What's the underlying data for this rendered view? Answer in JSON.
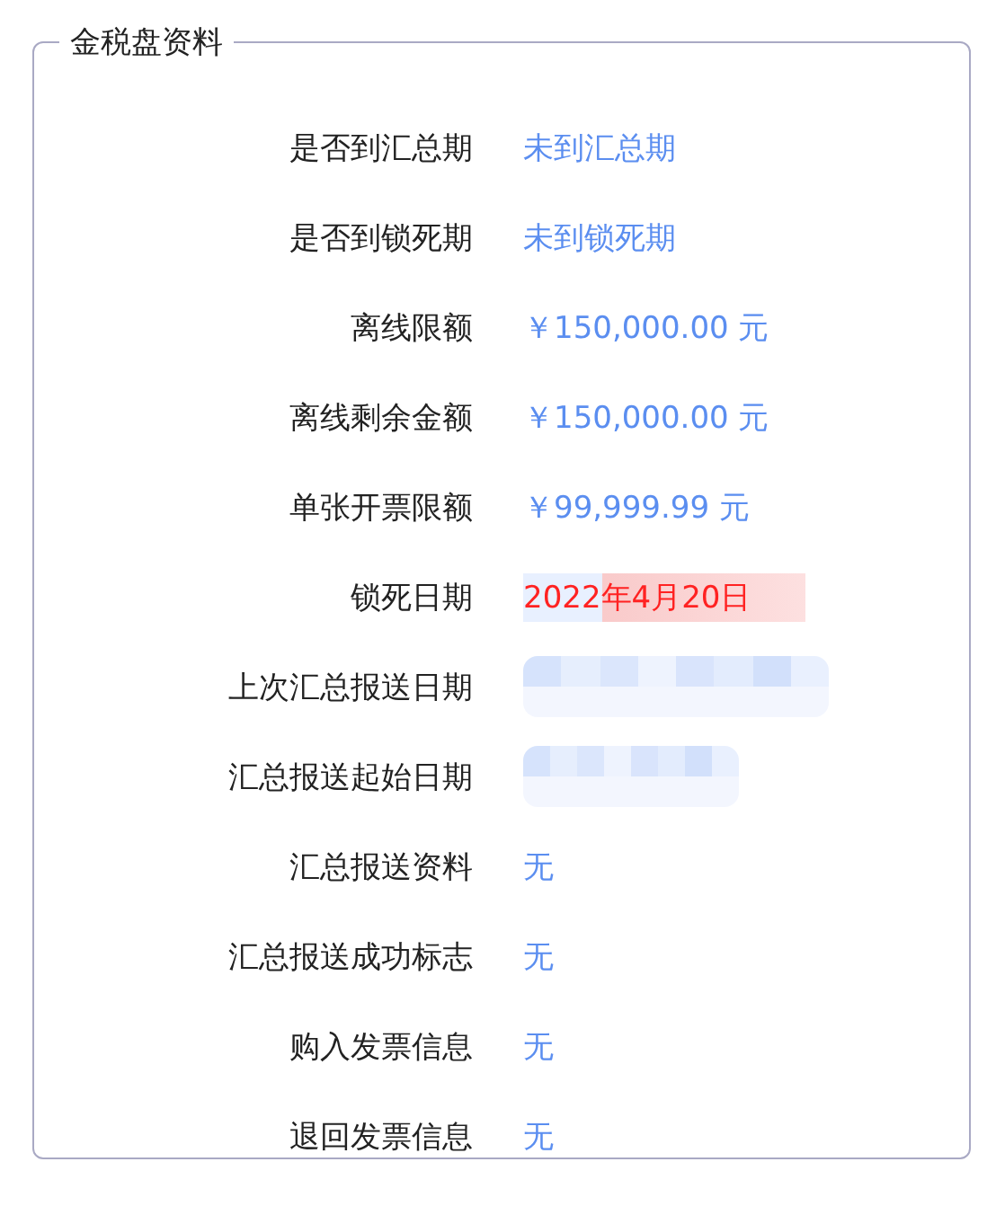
{
  "panel": {
    "title": "金税盘资料",
    "rows": [
      {
        "label": "是否到汇总期",
        "kind": "text",
        "value": "未到汇总期"
      },
      {
        "label": "是否到锁死期",
        "kind": "text",
        "value": "未到锁死期"
      },
      {
        "label": "离线限额",
        "kind": "text",
        "value": "￥150,000.00 元"
      },
      {
        "label": "离线剩余金额",
        "kind": "text",
        "value": "￥150,000.00 元"
      },
      {
        "label": "单张开票限额",
        "kind": "text",
        "value": "￥99,999.99 元"
      },
      {
        "label": "锁死日期",
        "kind": "alert",
        "value": "2022年4月20日"
      },
      {
        "label": "上次汇总报送日期",
        "kind": "redacted"
      },
      {
        "label": "汇总报送起始日期",
        "kind": "redacted"
      },
      {
        "label": "汇总报送资料",
        "kind": "text",
        "value": "无"
      },
      {
        "label": "汇总报送成功标志",
        "kind": "text",
        "value": "无"
      },
      {
        "label": "购入发票信息",
        "kind": "text",
        "value": "无"
      },
      {
        "label": "退回发票信息",
        "kind": "text",
        "value": "无"
      }
    ]
  }
}
